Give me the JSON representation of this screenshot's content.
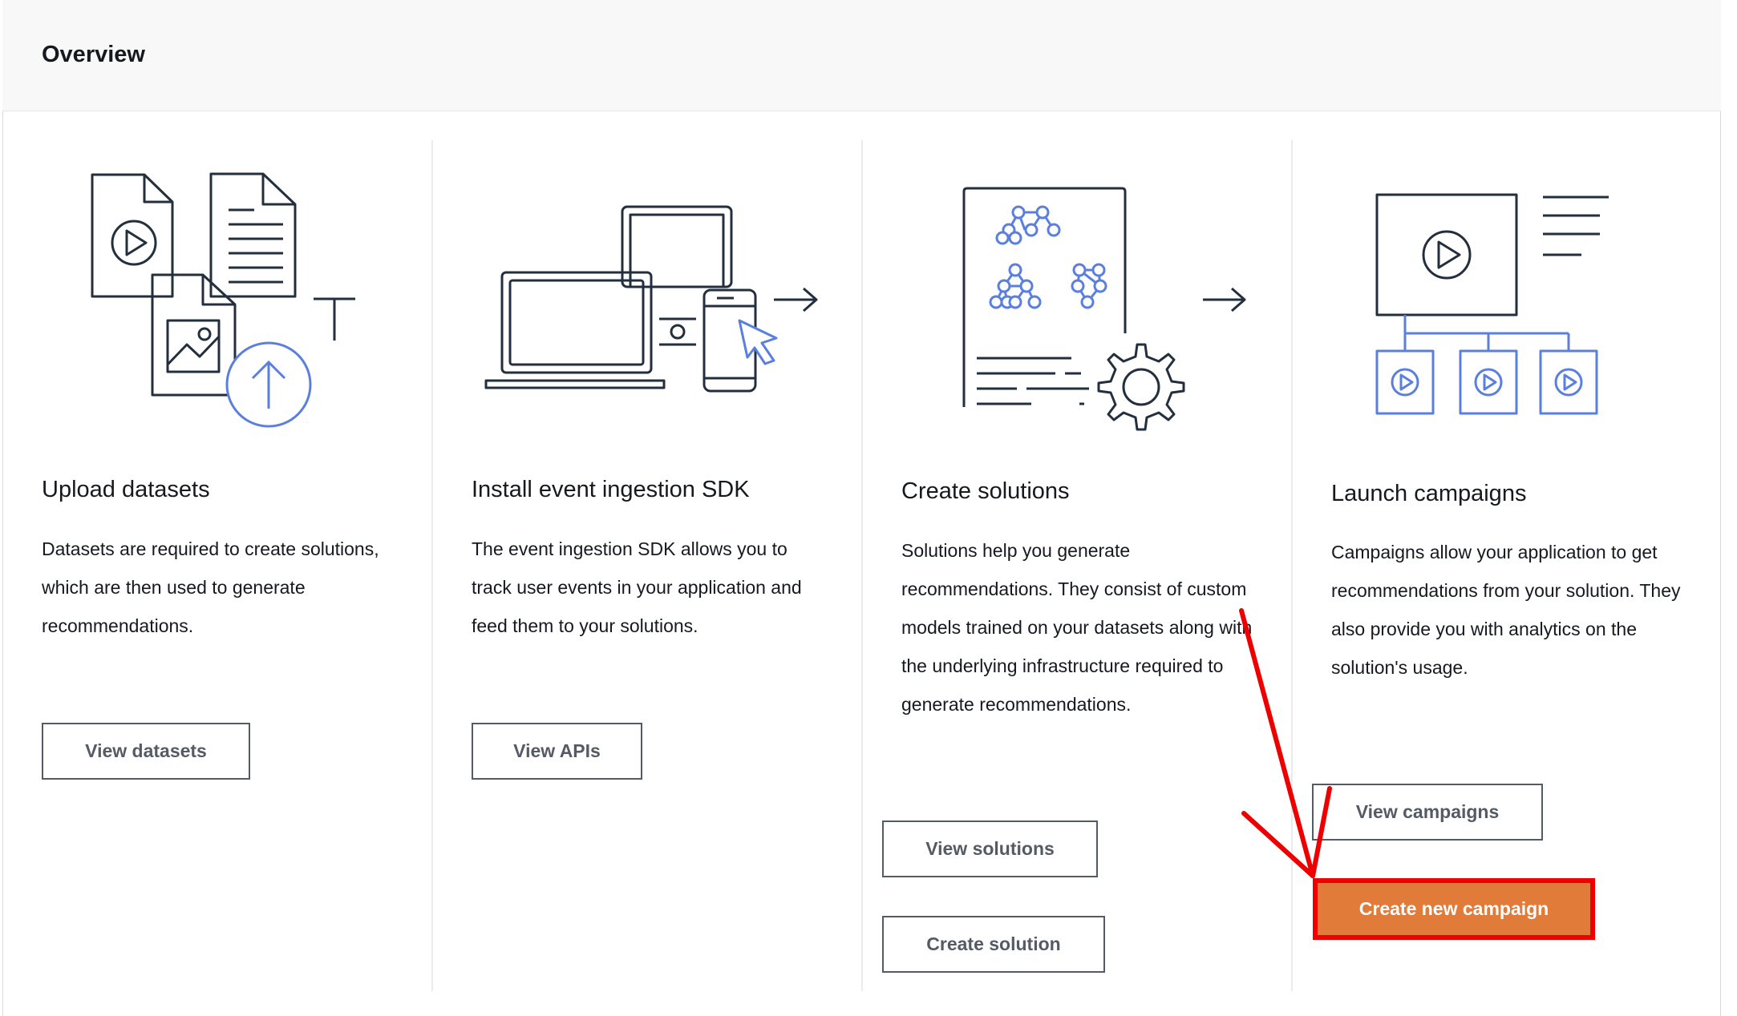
{
  "header": {
    "title": "Overview"
  },
  "cards": [
    {
      "icon": "upload-datasets-icon",
      "title": "Upload datasets",
      "description": "Datasets are required to create solutions, which are then used to generate recommendations.",
      "buttons": [
        "View datasets"
      ]
    },
    {
      "icon": "install-sdk-icon",
      "title": "Install event ingestion SDK",
      "description": "The event ingestion SDK allows you to track user events in your application and feed them to your solutions.",
      "buttons": [
        "View APIs"
      ]
    },
    {
      "icon": "create-solutions-icon",
      "title": "Create solutions",
      "description": "Solutions help you generate recommendations. They consist of custom models trained on your datasets along with the underlying infrastructure required to generate recommendations.",
      "buttons": [
        "View solutions",
        "Create solution"
      ]
    },
    {
      "icon": "launch-campaigns-icon",
      "title": "Launch campaigns",
      "description": "Campaigns allow your application to get recommendations from your solution. They also provide you with analytics on the solution's usage.",
      "buttons": [
        "View campaigns",
        "Create new campaign"
      ]
    }
  ],
  "colors": {
    "primary": "#e07b39",
    "annotation": "#ef0000",
    "illustration_blue": "#5a7fde",
    "illustration_dark": "#232f3e"
  }
}
